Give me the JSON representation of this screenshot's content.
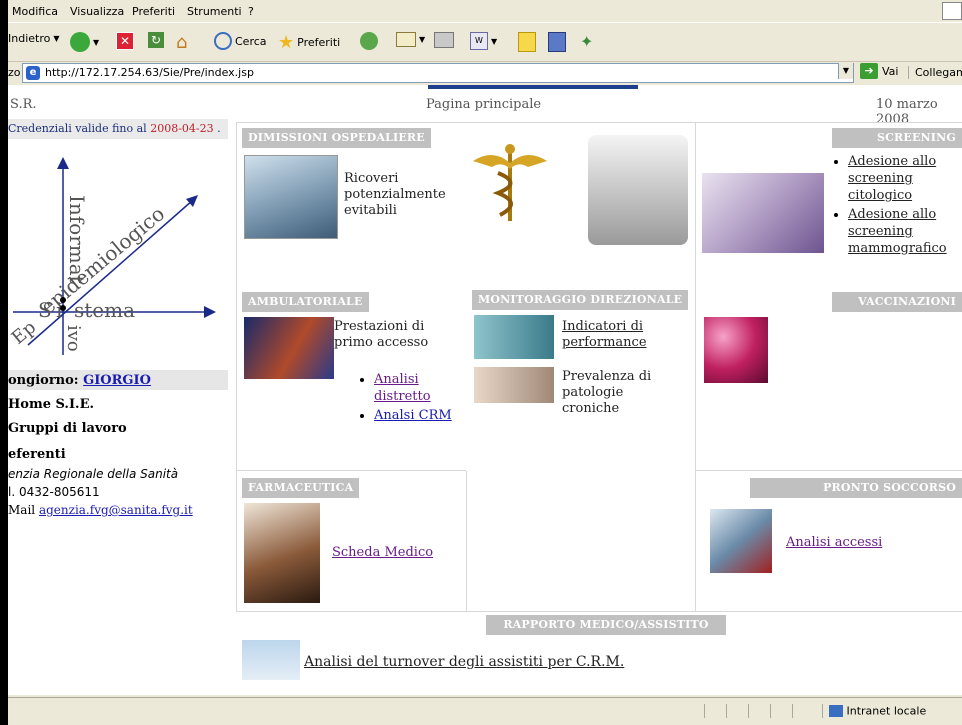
{
  "menu": {
    "items": [
      "Modifica",
      "Visualizza",
      "Preferiti",
      "Strumenti",
      "?"
    ]
  },
  "toolbar": {
    "back": "Indietro",
    "search": "Cerca",
    "favorites": "Preferiti"
  },
  "address": {
    "label": "zo",
    "url": "http://172.17.254.63/Sie/Pre/index.jsp",
    "go": "Vai",
    "links": "Collegame"
  },
  "header": {
    "left": "S.R.",
    "center": "Pagina principale",
    "right": "10 marzo 2008"
  },
  "credentials": {
    "text": "Credenziali valide fino al",
    "date": "2008-04-23",
    "end": "."
  },
  "logo": {
    "w1": "Informat",
    "w2": "epidemiologico",
    "w3": "S",
    "w4": "i",
    "w5": "stema",
    "w6": "Ep",
    "w7": "ivo"
  },
  "left": {
    "greeting": "ongiorno:",
    "user": "GIORGIO",
    "home": "Home S.I.E.",
    "groups": "Gruppi di lavoro",
    "refs": "eferenti",
    "agency": "enzia Regionale della Sanità",
    "phone": "l. 0432-805611",
    "mail_label": "Mail",
    "mail": "agenzia.fvg@sanita.fvg.it"
  },
  "sections": {
    "dimissioni": {
      "title": "DIMISSIONI OSPEDALIERE",
      "text": "Ricoveri potenzialmente evitabili"
    },
    "screening": {
      "title": "SCREENING",
      "links": [
        "Adesione allo screening citologico",
        "Adesione allo screening mammografico"
      ]
    },
    "ambulatoriale": {
      "title": "AMBULATORIALE",
      "text": "Prestazioni di primo accesso",
      "links": [
        "Analisi distretto",
        "Analsi CRM"
      ]
    },
    "monitoraggio": {
      "title": "MONITORAGGIO DIREZIONALE",
      "link": "Indicatori di performance",
      "text": "Prevalenza di patologie croniche"
    },
    "vaccinazioni": {
      "title": "VACCINAZIONI"
    },
    "farmaceutica": {
      "title": "FARMACEUTICA",
      "link": "Scheda Medico"
    },
    "pronto": {
      "title": "PRONTO SOCCORSO",
      "link": "Analisi accessi"
    },
    "rapporto": {
      "title": "RAPPORTO MEDICO/ASSISTITO",
      "link": "Analisi del turnover degli assistiti per C.R.M."
    }
  },
  "status": {
    "zone": "Intranet locale"
  }
}
